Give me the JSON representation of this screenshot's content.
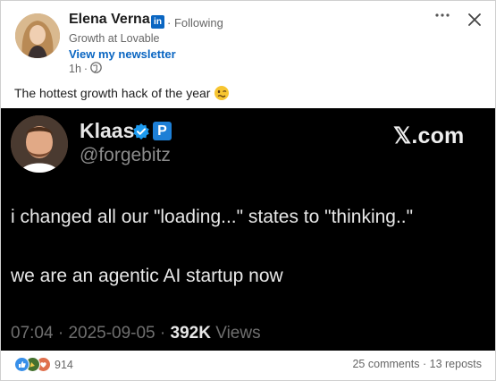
{
  "post": {
    "author_name": "Elena Verna",
    "linkedin_badge": "in",
    "follow_status": "Following",
    "separator": "·",
    "headline": "Growth at Lovable",
    "newsletter_link": "View my newsletter",
    "time_ago": "1h",
    "text": "The hottest growth hack of the year",
    "emoji_icon": "woozy-face-icon",
    "more_icon": "ellipsis-icon",
    "close_icon": "close-icon"
  },
  "tweet": {
    "name": "Klaas",
    "handle": "@forgebitz",
    "p_badge": "P",
    "brand": "𝕏.com",
    "line1": "i changed all our \"loading...\" states to \"thinking..\"",
    "line2": "we are an agentic AI startup now",
    "time": "07:04",
    "date": "2025-09-05",
    "views_count": "392K",
    "views_label": "Views",
    "dot": "·"
  },
  "social": {
    "reaction_icons": [
      "like-icon",
      "celebrate-icon",
      "love-icon"
    ],
    "reaction_count": "914",
    "comments_reposts": "25 comments · 13 reposts"
  },
  "colors": {
    "link_blue": "#0a66c2",
    "tweet_bg": "#000000",
    "verified_blue": "#1d9bf0"
  }
}
